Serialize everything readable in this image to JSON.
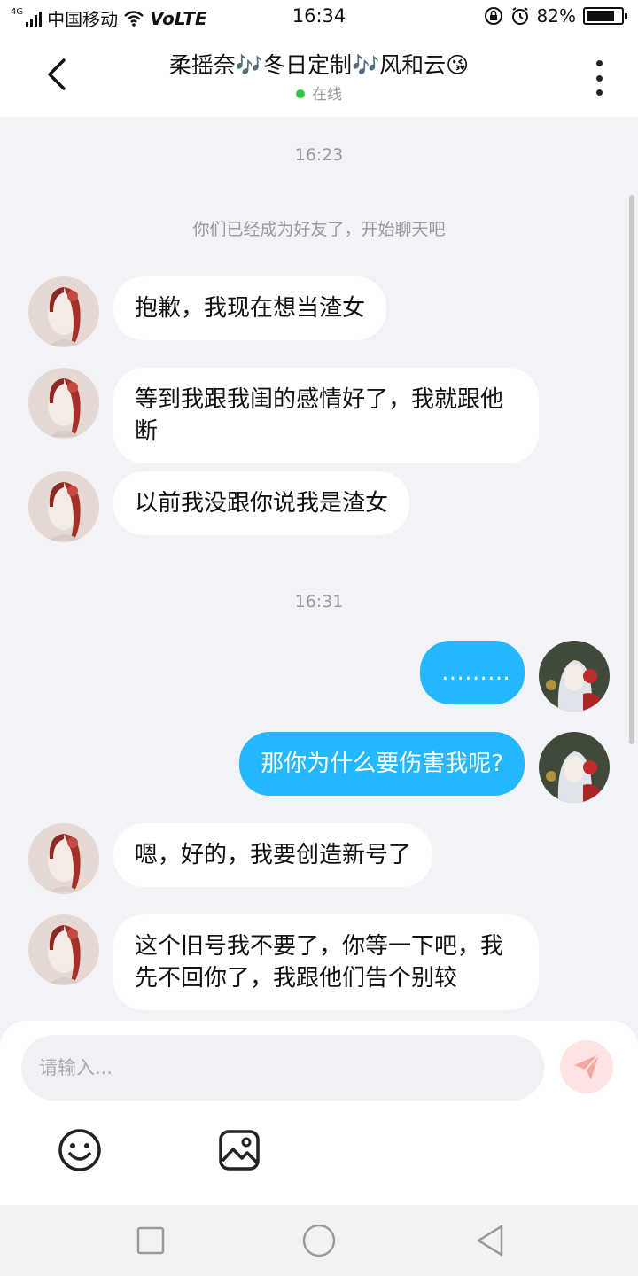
{
  "status_bar": {
    "network_tag": "4G",
    "carrier": "中国移动",
    "volte": "VoLTE",
    "time": "16:34",
    "battery": "82%",
    "battery_level": 0.82,
    "icons": [
      "signal-icon",
      "wifi-icon",
      "lock-rotation-icon",
      "alarm-icon",
      "battery-icon"
    ]
  },
  "header": {
    "title": "柔摇奈🎶冬日定制🎶风和云😘",
    "status": "在线",
    "status_color": "#2ecc40"
  },
  "chat": {
    "timestamp_1": "16:23",
    "system_notice": "你们已经成为好友了，开始聊天吧",
    "timestamp_2": "16:31",
    "messages": [
      {
        "side": "in",
        "text": "抱歉，我现在想当渣女"
      },
      {
        "side": "in",
        "text": "等到我跟我闺的感情好了，我就跟他断"
      },
      {
        "side": "in",
        "text": "以前我没跟你说我是渣女"
      },
      {
        "side": "out",
        "text": "………"
      },
      {
        "side": "out",
        "text": "那你为什么要伤害我呢?"
      },
      {
        "side": "in",
        "text": "嗯，好的，我要创造新号了"
      },
      {
        "side": "in",
        "text": "这个旧号我不要了，你等一下吧，我先不回你了，我跟他们告个别较"
      }
    ]
  },
  "input": {
    "placeholder": "请输入..."
  },
  "colors": {
    "outgoing_bubble": "#25b7ff",
    "incoming_bubble": "#ffffff",
    "background": "#f2f3f7",
    "send_button": "#fde4e2"
  }
}
